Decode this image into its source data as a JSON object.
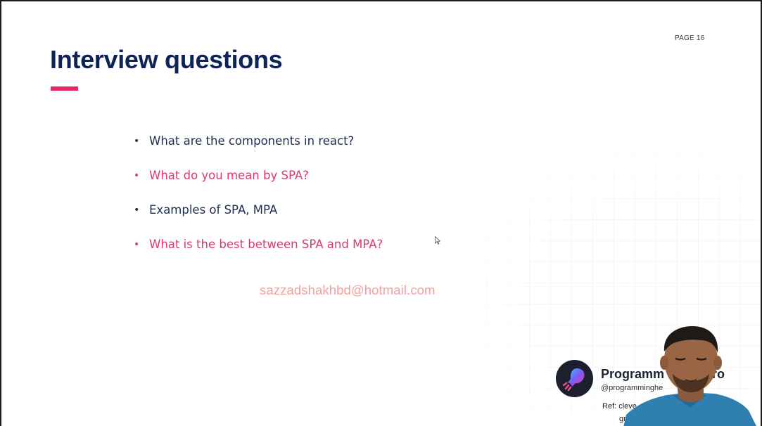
{
  "slide": {
    "page_label": "PAGE 16",
    "title": "Interview questions",
    "accent_color": "#e8266a",
    "title_color": "#0e2356"
  },
  "questions": [
    {
      "text": "What are the components in react?",
      "color": "dark"
    },
    {
      "text": "What do you mean by SPA?",
      "color": "pink"
    },
    {
      "text": "Examples of SPA, MPA",
      "color": "dark"
    },
    {
      "text": "What is the best between SPA and MPA?",
      "color": "pink"
    }
  ],
  "bullet_glyph": "•",
  "watermark": "sazzadshakhbd@hotmail.com",
  "brand": {
    "name_visible_start": "Programm",
    "name_visible_end": "ro",
    "handle": "@programminghe",
    "ref_line1": "Ref: cleve",
    "ref_line2": "gr",
    "logo_icon": "rocket-logo-icon"
  },
  "overlay": {
    "webcam": "presenter-webcam",
    "cursor_icon": "mouse-cursor-icon"
  }
}
